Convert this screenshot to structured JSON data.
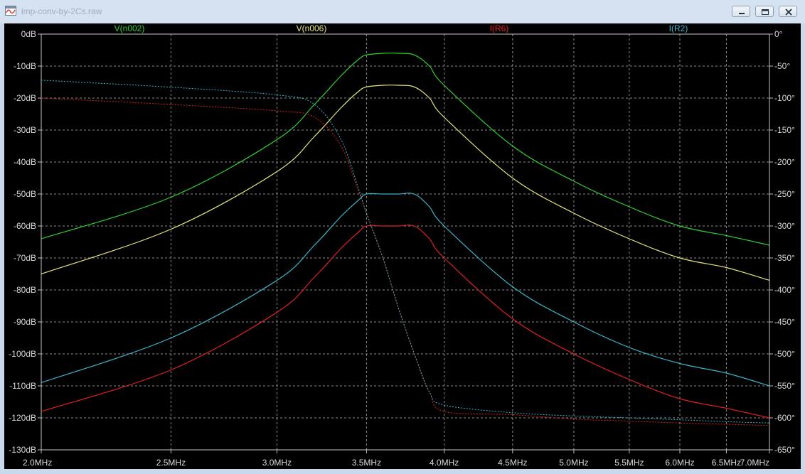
{
  "window": {
    "title": "imp-conv-by-2Cs.raw",
    "icons": {
      "app": "waveform-icon",
      "minimize": "minimize-icon",
      "maximize": "maximize-icon",
      "close": "close-icon"
    }
  },
  "chart_data": {
    "type": "line",
    "x_scale": "log",
    "xlim": [
      "2.0MHz",
      "7.0MHz"
    ],
    "x_ticks": [
      "2.0MHz",
      "2.5MHz",
      "3.0MHz",
      "3.5MHz",
      "4.0MHz",
      "4.5MHz",
      "5.0MHz",
      "5.5MHz",
      "6.0MHz",
      "6.5MHz",
      "7.0MHz"
    ],
    "x_ticks_mhz": [
      2.0,
      2.5,
      3.0,
      3.5,
      4.0,
      4.5,
      5.0,
      5.5,
      6.0,
      6.5,
      7.0
    ],
    "ylim_db": [
      -130,
      0
    ],
    "y_ticks_left": [
      "0dB",
      "-10dB",
      "-20dB",
      "-30dB",
      "-40dB",
      "-50dB",
      "-60dB",
      "-70dB",
      "-80dB",
      "-90dB",
      "-100dB",
      "-110dB",
      "-120dB",
      "-130dB"
    ],
    "ylim_phase_deg": [
      -650,
      0
    ],
    "y_ticks_right": [
      "0°",
      "-50°",
      "-100°",
      "-150°",
      "-200°",
      "-250°",
      "-300°",
      "-350°",
      "-400°",
      "-450°",
      "-500°",
      "-550°",
      "-600°",
      "-650°"
    ],
    "grid": true,
    "legend_position": "top",
    "x_mhz": [
      2.0,
      2.5,
      3.0,
      3.2,
      3.35,
      3.45,
      3.5,
      3.6,
      3.7,
      3.8,
      3.9,
      4.0,
      4.5,
      5.0,
      5.5,
      6.0,
      6.5,
      7.0
    ],
    "series": [
      {
        "name": "V(n002)",
        "color": "#30d030",
        "magnitude_db": [
          -64,
          -51,
          -33,
          -22,
          -13,
          -8,
          -6.5,
          -6,
          -6,
          -6.5,
          -10,
          -16,
          -35,
          -46,
          -54,
          -60,
          -63,
          -66
        ],
        "phase_deg": null
      },
      {
        "name": "V(n006)",
        "color": "#e6e67a",
        "magnitude_db": [
          -75,
          -61,
          -43,
          -32,
          -23,
          -18,
          -16.5,
          -16,
          -16,
          -16.5,
          -20,
          -26,
          -45,
          -56,
          -64,
          -70,
          -73,
          -77
        ],
        "phase_deg": null
      },
      {
        "name": "I(R6)",
        "color": "#e02020",
        "magnitude_db": [
          -118,
          -105,
          -87,
          -76,
          -67,
          -62,
          -60,
          -60,
          -60,
          -60,
          -64,
          -70,
          -89,
          -100,
          -108,
          -114,
          -117,
          -120
        ],
        "phase_deg": [
          -100,
          -110,
          -120,
          -130,
          -175,
          -245,
          -280,
          -350,
          -430,
          -500,
          -560,
          -590,
          -595,
          -602,
          -605,
          -608,
          -610,
          -612
        ]
      },
      {
        "name": "I(R2)",
        "color": "#3cb4c8",
        "magnitude_db": [
          -109,
          -95,
          -77,
          -66,
          -57,
          -52,
          -50,
          -50,
          -50,
          -50,
          -54,
          -60,
          -79,
          -90,
          -98,
          -103,
          -106,
          -110
        ],
        "phase_deg": [
          -72,
          -83,
          -95,
          -110,
          -165,
          -240,
          -280,
          -350,
          -430,
          -500,
          -560,
          -580,
          -592,
          -597,
          -600,
          -603,
          -606,
          -608
        ]
      }
    ]
  }
}
